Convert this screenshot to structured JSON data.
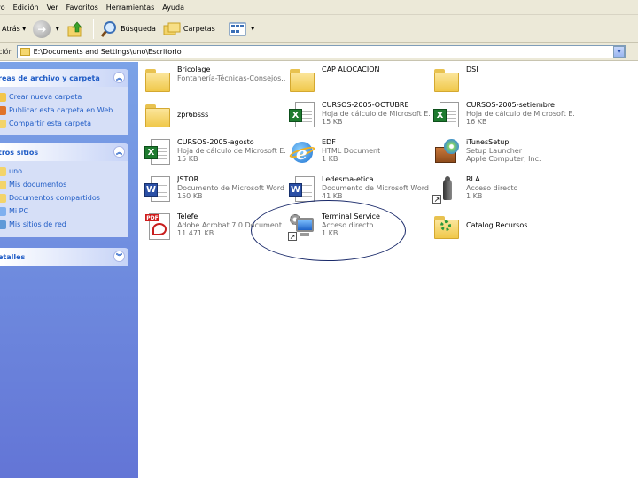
{
  "menu": [
    "vo",
    "Edición",
    "Ver",
    "Favoritos",
    "Herramientas",
    "Ayuda"
  ],
  "toolbar": {
    "back_label": "Atrás",
    "search_label": "Búsqueda",
    "folders_label": "Carpetas"
  },
  "address": {
    "label": "ción",
    "value": "E:\\Documents and Settings\\uno\\Escritorio"
  },
  "tasks_panel": {
    "title": "reas de archivo y carpeta",
    "items": [
      "Crear nueva carpeta",
      "Publicar esta carpeta en Web",
      "Compartir esta carpeta"
    ]
  },
  "places_panel": {
    "title": "tros sitios",
    "items": [
      "uno",
      "Mis documentos",
      "Documentos compartidos",
      "Mi PC",
      "Mis sitios de red"
    ]
  },
  "details_panel": {
    "title": "etalles"
  },
  "files": [
    {
      "name": "Bricolage",
      "line2": "Fontanería-Técnicas-Consejos...",
      "line3": ""
    },
    {
      "name": "CAP ALOCACION",
      "line2": "",
      "line3": ""
    },
    {
      "name": "DSI",
      "line2": "",
      "line3": ""
    },
    {
      "name": "zpr6bsss",
      "line2": "",
      "line3": ""
    },
    {
      "name": "CURSOS-2005-OCTUBRE",
      "line2": "Hoja de cálculo de Microsoft E...",
      "line3": "15 KB"
    },
    {
      "name": "CURSOS-2005-setiembre",
      "line2": "Hoja de cálculo de Microsoft E...",
      "line3": "16 KB"
    },
    {
      "name": "CURSOS-2005-agosto",
      "line2": "Hoja de cálculo de Microsoft E...",
      "line3": "15 KB"
    },
    {
      "name": "EDF",
      "line2": "HTML Document",
      "line3": "1 KB"
    },
    {
      "name": "iTunesSetup",
      "line2": "Setup Launcher",
      "line3": "Apple Computer, Inc."
    },
    {
      "name": "JSTOR",
      "line2": "Documento de Microsoft Word",
      "line3": "150 KB"
    },
    {
      "name": "Ledesma-etica",
      "line2": "Documento de Microsoft Word",
      "line3": "41 KB"
    },
    {
      "name": "RLA",
      "line2": "Acceso directo",
      "line3": "1 KB"
    },
    {
      "name": "Telefe",
      "line2": "Adobe Acrobat 7.0 Document",
      "line3": "11.471 KB"
    },
    {
      "name": "Terminal Service",
      "line2": "Acceso directo",
      "line3": "1 KB"
    },
    {
      "name": "Catalog Recursos",
      "line2": "",
      "line3": ""
    }
  ],
  "colors": {
    "task_pane_top": "#7ba2e7",
    "task_pane_bottom": "#6375d6",
    "link_blue": "#215dc6",
    "chrome": "#ece9d8"
  }
}
